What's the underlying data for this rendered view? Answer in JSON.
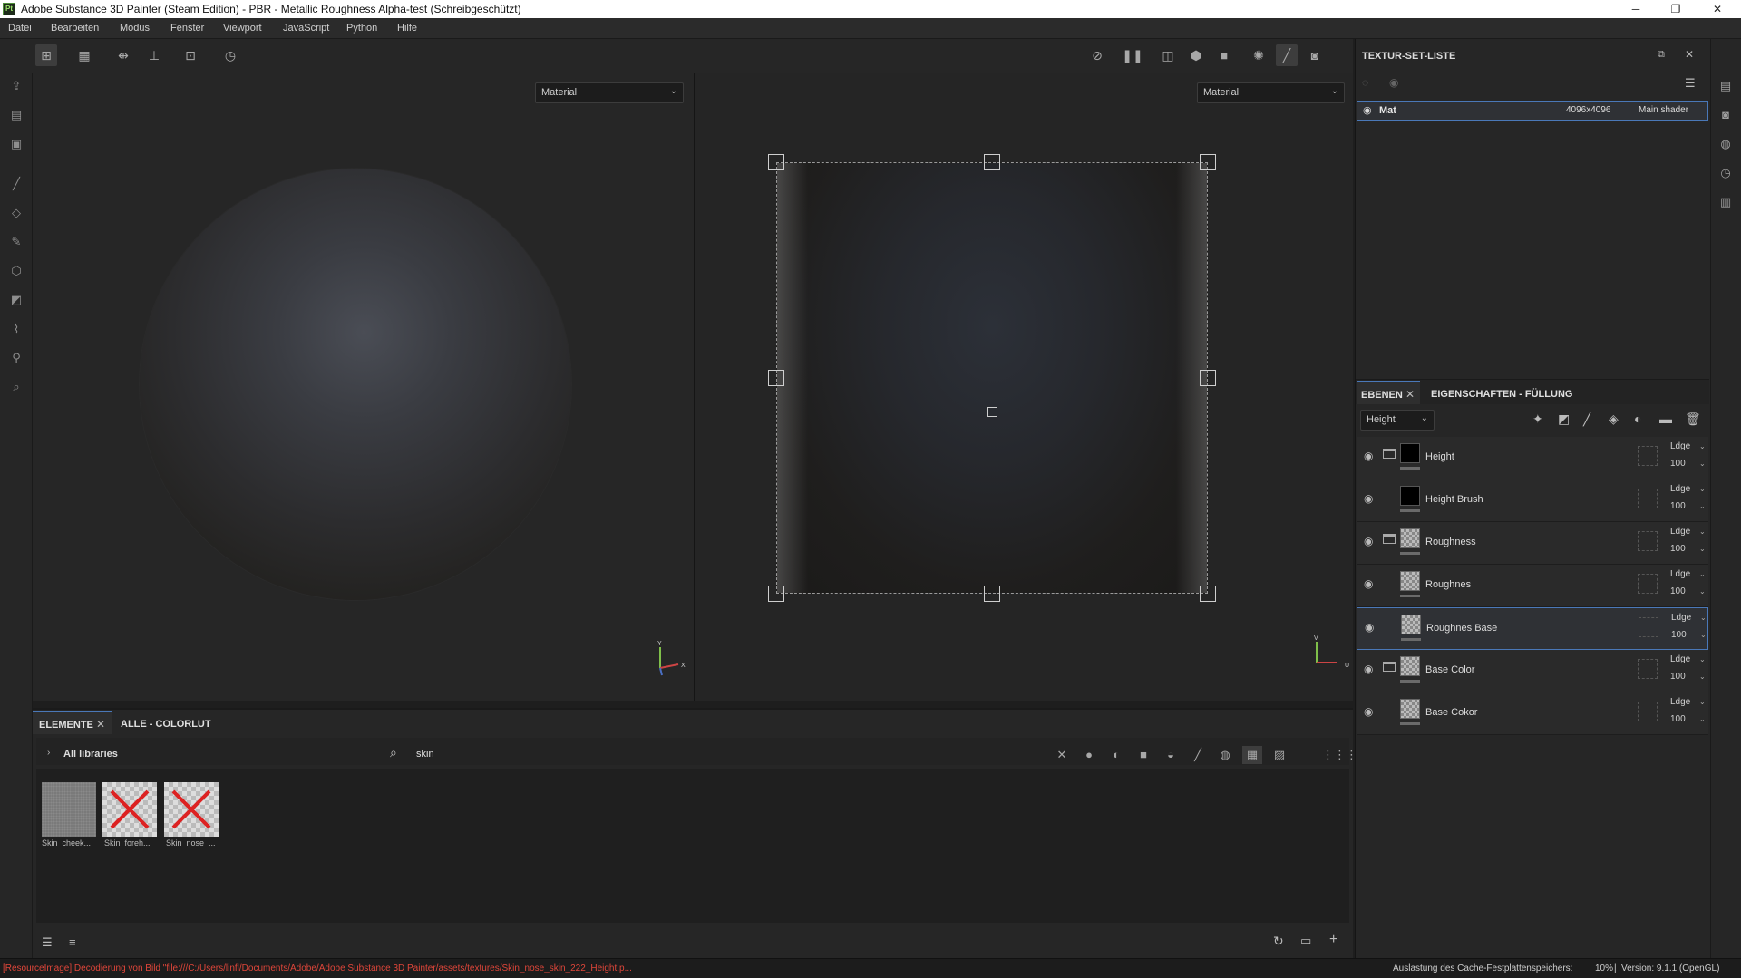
{
  "window": {
    "icon_label": "Pt",
    "title": "Adobe Substance 3D Painter (Steam Edition) - PBR - Metallic Roughness Alpha-test (Schreibgeschützt)",
    "minimize": "─",
    "maximize": "❐",
    "close": "✕"
  },
  "menu": [
    "Datei",
    "Bearbeiten",
    "Modus",
    "Fenster",
    "Viewport",
    "JavaScript",
    "Python",
    "Hilfe"
  ],
  "viewport3d": {
    "channel": "Material"
  },
  "viewport2d": {
    "channel": "Material"
  },
  "axes3d": {
    "y": "Y",
    "x": "X"
  },
  "axes2d": {
    "v": "V",
    "u": "U"
  },
  "texture_set_list": {
    "title": "TEXTUR-SET-LISTE",
    "item": {
      "name": "Mat",
      "resolution": "4096x4096",
      "shader": "Main shader"
    }
  },
  "layers_panel": {
    "tab_layers": "EBENEN",
    "tab_properties": "EIGENSCHAFTEN - FÜLLUNG",
    "channel": "Height",
    "layers": [
      {
        "name": "Height",
        "folder": true,
        "thumb": "black",
        "blend": "Ldge",
        "opacity": "100",
        "selected": false
      },
      {
        "name": "Height Brush",
        "folder": false,
        "thumb": "black",
        "blend": "Ldge",
        "opacity": "100",
        "selected": false
      },
      {
        "name": "Roughness",
        "folder": true,
        "thumb": "check",
        "blend": "Ldge",
        "opacity": "100",
        "selected": false
      },
      {
        "name": "Roughnes",
        "folder": false,
        "thumb": "check",
        "blend": "Ldge",
        "opacity": "100",
        "selected": false
      },
      {
        "name": "Roughnes Base",
        "folder": false,
        "thumb": "check",
        "blend": "Ldge",
        "opacity": "100",
        "selected": true
      },
      {
        "name": "Base Color",
        "folder": true,
        "thumb": "check",
        "blend": "Ldge",
        "opacity": "100",
        "selected": false
      },
      {
        "name": "Base Cokor",
        "folder": false,
        "thumb": "check",
        "blend": "Ldge",
        "opacity": "100",
        "selected": false
      }
    ]
  },
  "assets_panel": {
    "tab_elements": "ELEMENTE",
    "tab_colorlut": "ALLE - COLORLUT",
    "library": "All libraries",
    "search_value": "skin",
    "items": [
      "Skin_cheek...",
      "Skin_foreh...",
      "Skin_nose_..."
    ]
  },
  "status": {
    "message": "[ResourceImage] Decodierung von Bild \"file:///C:/Users/linfl/Documents/Adobe/Adobe Substance 3D Painter/assets/textures/Skin_nose_skin_222_Height.p...",
    "cache_label": "Auslastung des Cache-Festplattenspeichers:",
    "cache_value": "10%",
    "version": "Version: 9.1.1 (OpenGL)"
  },
  "colors": {
    "accent": "#4a78b8",
    "error_text": "#e0463a",
    "panel": "#262626"
  }
}
